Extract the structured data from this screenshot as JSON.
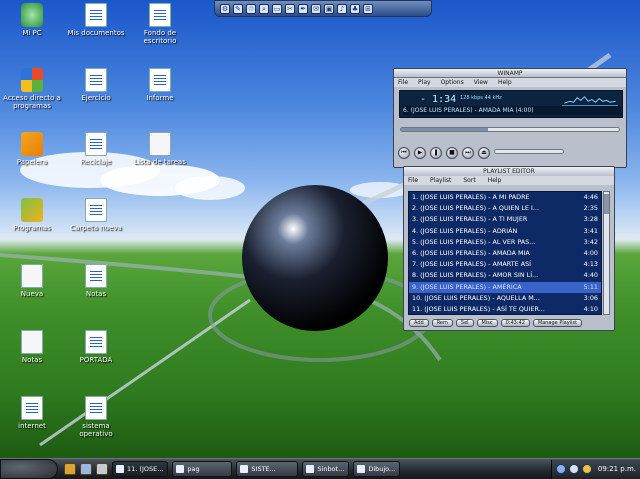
{
  "desktop": {
    "icons": [
      {
        "label": "Mi PC",
        "icon": "my-computer-icon"
      },
      {
        "label": "Mis documentos",
        "icon": "folder-icon"
      },
      {
        "label": "Fondo de escritorio",
        "icon": "word-doc-icon"
      },
      {
        "label": "Acceso directo a programas",
        "icon": "shortcut-icon"
      },
      {
        "label": "Papelera",
        "icon": "recycle-bin-icon"
      },
      {
        "label": "Ejercicio",
        "icon": "word-doc-icon"
      },
      {
        "label": "Informe",
        "icon": "word-doc-icon"
      },
      {
        "label": "Reciclaje",
        "icon": "word-doc-icon"
      },
      {
        "label": "Lista de tareas",
        "icon": "word-doc-icon"
      },
      {
        "label": "Programas",
        "icon": "folder-icon"
      },
      {
        "label": "Carpeta nueva",
        "icon": "folder-icon"
      },
      {
        "label": "Nueva",
        "icon": "word-doc-icon"
      },
      {
        "label": "Notas",
        "icon": "word-doc-icon"
      },
      {
        "label": "PORTADA",
        "icon": "word-doc-icon"
      },
      {
        "label": "internet",
        "icon": "word-doc-icon"
      },
      {
        "label": "sistema operativo",
        "icon": "word-doc-icon"
      }
    ]
  },
  "winamp": {
    "title": "WINAMP",
    "menu": [
      "File",
      "Play",
      "Options",
      "View",
      "Help"
    ],
    "time": "- 1:34",
    "kbps": "128 kbps 44 kHz",
    "ticker": "6. (JOSE LUIS PERALES) - AMADA MIA (4:00)",
    "seek_percent": 40,
    "controls": [
      "prev-icon",
      "play-icon",
      "pause-icon",
      "stop-icon",
      "next-icon",
      "eject-icon"
    ]
  },
  "playlist": {
    "title": "PLAYLIST EDITOR",
    "menu": [
      "File",
      "Playlist",
      "Sort",
      "Help"
    ],
    "items": [
      {
        "title": "1. (JOSE LUIS PERALES) - A MI PADRE",
        "dur": "4:46"
      },
      {
        "title": "2. (JOSE LUIS PERALES) - A QUIEN LE I...",
        "dur": "2:35"
      },
      {
        "title": "3. (JOSE LUIS PERALES) - A TI MUJER",
        "dur": "3:28"
      },
      {
        "title": "4. (JOSE LUIS PERALES) - ADRIÁN",
        "dur": "3:41"
      },
      {
        "title": "5. (JOSE LUIS PERALES) - AL VER PAS...",
        "dur": "3:42"
      },
      {
        "title": "6. (JOSE LUIS PERALES) - AMADA MIA",
        "dur": "4:00"
      },
      {
        "title": "7. (JOSE LUIS PERALES) - AMARTE ASÍ",
        "dur": "4:13"
      },
      {
        "title": "8. (JOSE LUIS PERALES) - AMOR SIN LÍ...",
        "dur": "4:40"
      },
      {
        "title": "9. (JOSE LUIS PERALES) - AMÉRICA",
        "dur": "5:11"
      },
      {
        "title": "10. (JOSE LUIS PERALES) - AQUELLA M...",
        "dur": "3:06"
      },
      {
        "title": "11. (JOSE LUIS PERALES) - ASÍ TE QUIER...",
        "dur": "4:10"
      }
    ],
    "selected_index": 8,
    "buttons": [
      "Add",
      "Rem",
      "Sel",
      "Misc",
      "0:43:42",
      "Manage Playlist"
    ]
  },
  "taskbar": {
    "tasks": [
      "11. (JOSE...",
      "pag",
      "SISTE...",
      "Sinbot...",
      "Dibujo..."
    ],
    "clock": "09:21 p.m."
  },
  "colors": {
    "accent": "#3a63c9",
    "sky": "#4b86de",
    "grass": "#3f8f2a"
  }
}
